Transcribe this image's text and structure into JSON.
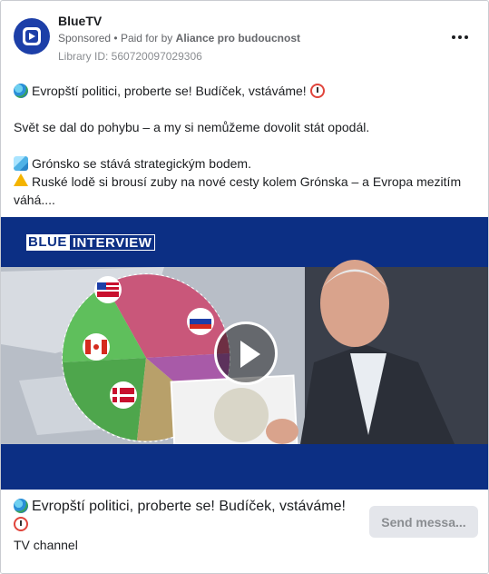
{
  "ad": {
    "page_name": "BlueTV",
    "sponsored_label": "Sponsored",
    "separator": "•",
    "paid_for_prefix": "Paid for by",
    "paid_for_by": "Aliance pro budoucnost",
    "library_id": "Library ID: 560720097029306",
    "more_icon": "more-horizontal-icon"
  },
  "body": {
    "line1": "Evropští politici, proberte se! Budíček, vstáváme!",
    "line2": "Svět se dal do pohybu – a my si nemůžeme dovolit stát opodál.",
    "line3": "Grónsko se stává strategickým bodem.",
    "line4": "Ruské lodě si brousí zuby na nové cesty kolem Grónska – a Evropa mezitím váhá...."
  },
  "media": {
    "banner_part1": "BLUE",
    "banner_part2": "INTERVIEW",
    "play_icon": "play-icon"
  },
  "footer": {
    "headline": "Evropští politici, proberte se! Budíček, vstáváme!",
    "subline": "TV channel",
    "cta_label": "Send messa..."
  },
  "colors": {
    "brand_blue": "#1d3fa8",
    "video_blue": "#0c2f84",
    "muted_text": "#65676b",
    "cta_bg": "#e4e6eb"
  }
}
